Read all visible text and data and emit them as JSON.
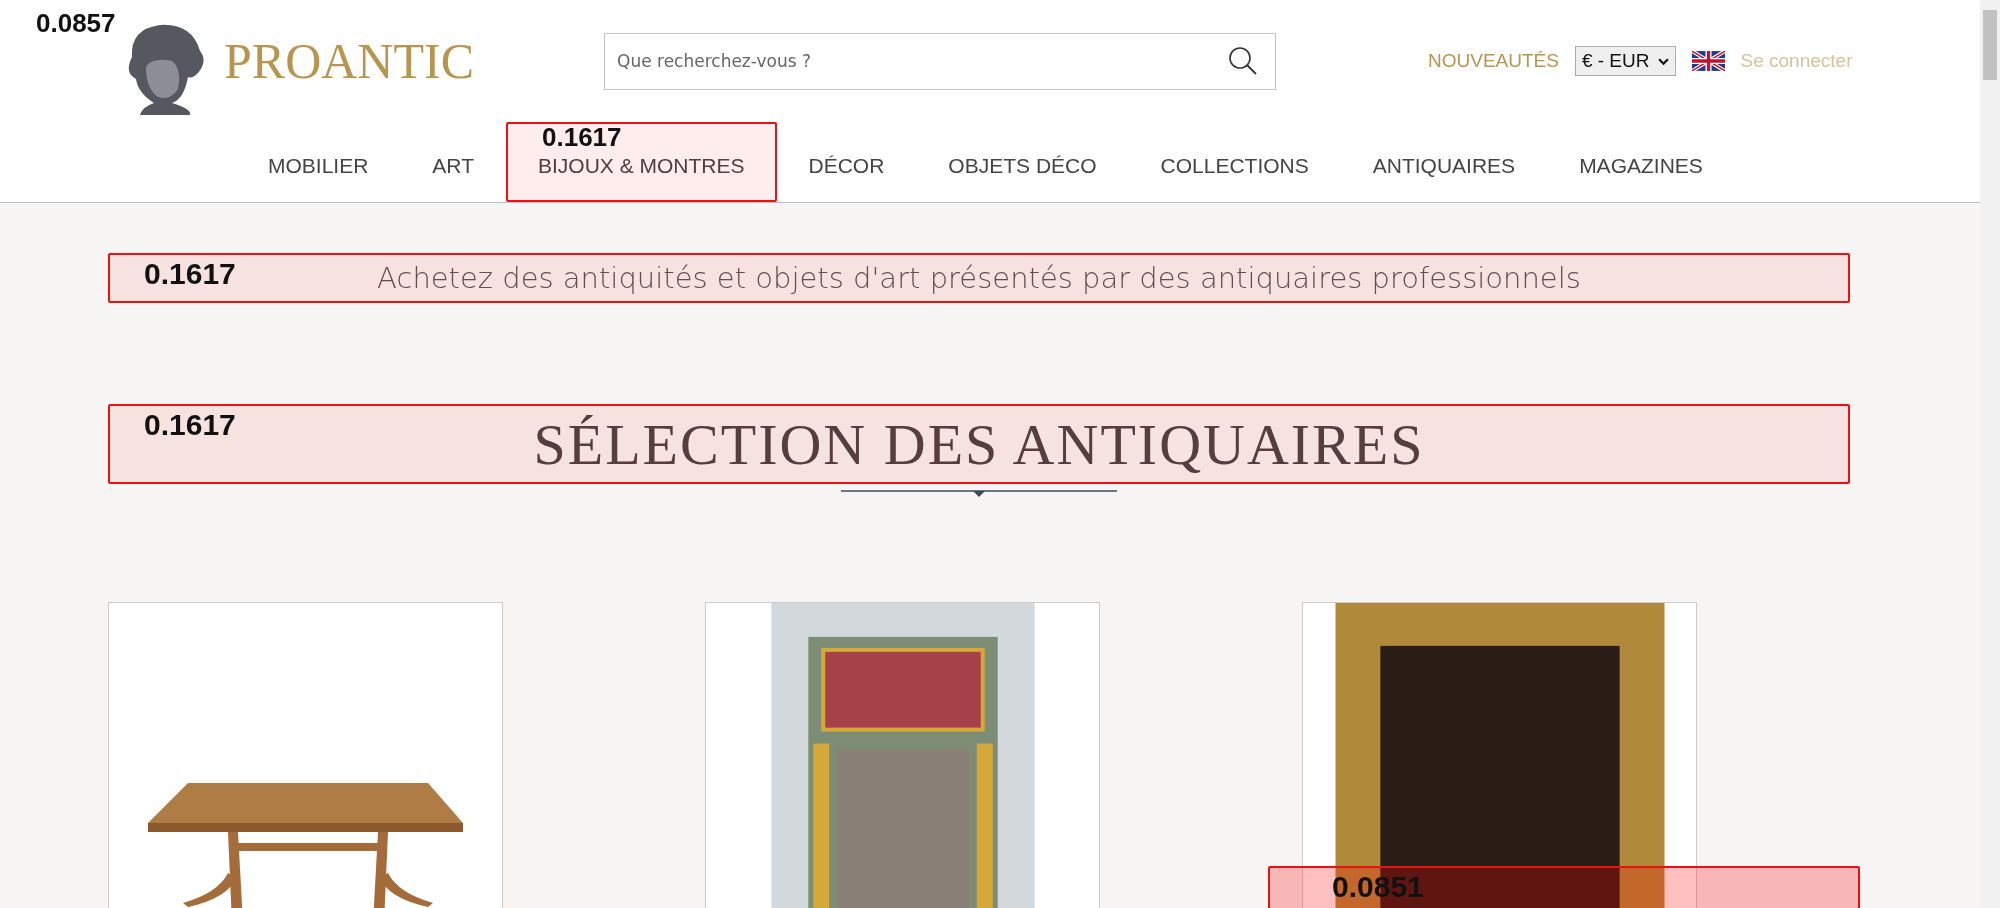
{
  "header": {
    "logo": {
      "text": "PROANTIC",
      "overlay_score": "0.0857"
    },
    "search": {
      "placeholder": "Que recherchez-vous ?"
    },
    "new_link": "NOUVEAUTÉS",
    "currency": "€ - EUR",
    "login": "Se connecter"
  },
  "nav": [
    {
      "label": "MOBILIER"
    },
    {
      "label": "ART"
    },
    {
      "label": "BIJOUX & MONTRES",
      "overlay_score": "0.1617"
    },
    {
      "label": "DÉCOR"
    },
    {
      "label": "OBJETS DÉCO"
    },
    {
      "label": "COLLECTIONS"
    },
    {
      "label": "ANTIQUAIRES"
    },
    {
      "label": "MAGAZINES"
    }
  ],
  "tagline": {
    "text": "Achetez des antiquités et objets d'art présentés par des antiquaires professionnels",
    "overlay_score": "0.1617"
  },
  "section_title": {
    "text": "SÉLECTION DES ANTIQUAIRES",
    "overlay_score": "0.1617"
  },
  "products": [
    {
      "kind": "table"
    },
    {
      "kind": "mirror"
    },
    {
      "kind": "portrait",
      "overlay_score": "0.0851"
    }
  ]
}
